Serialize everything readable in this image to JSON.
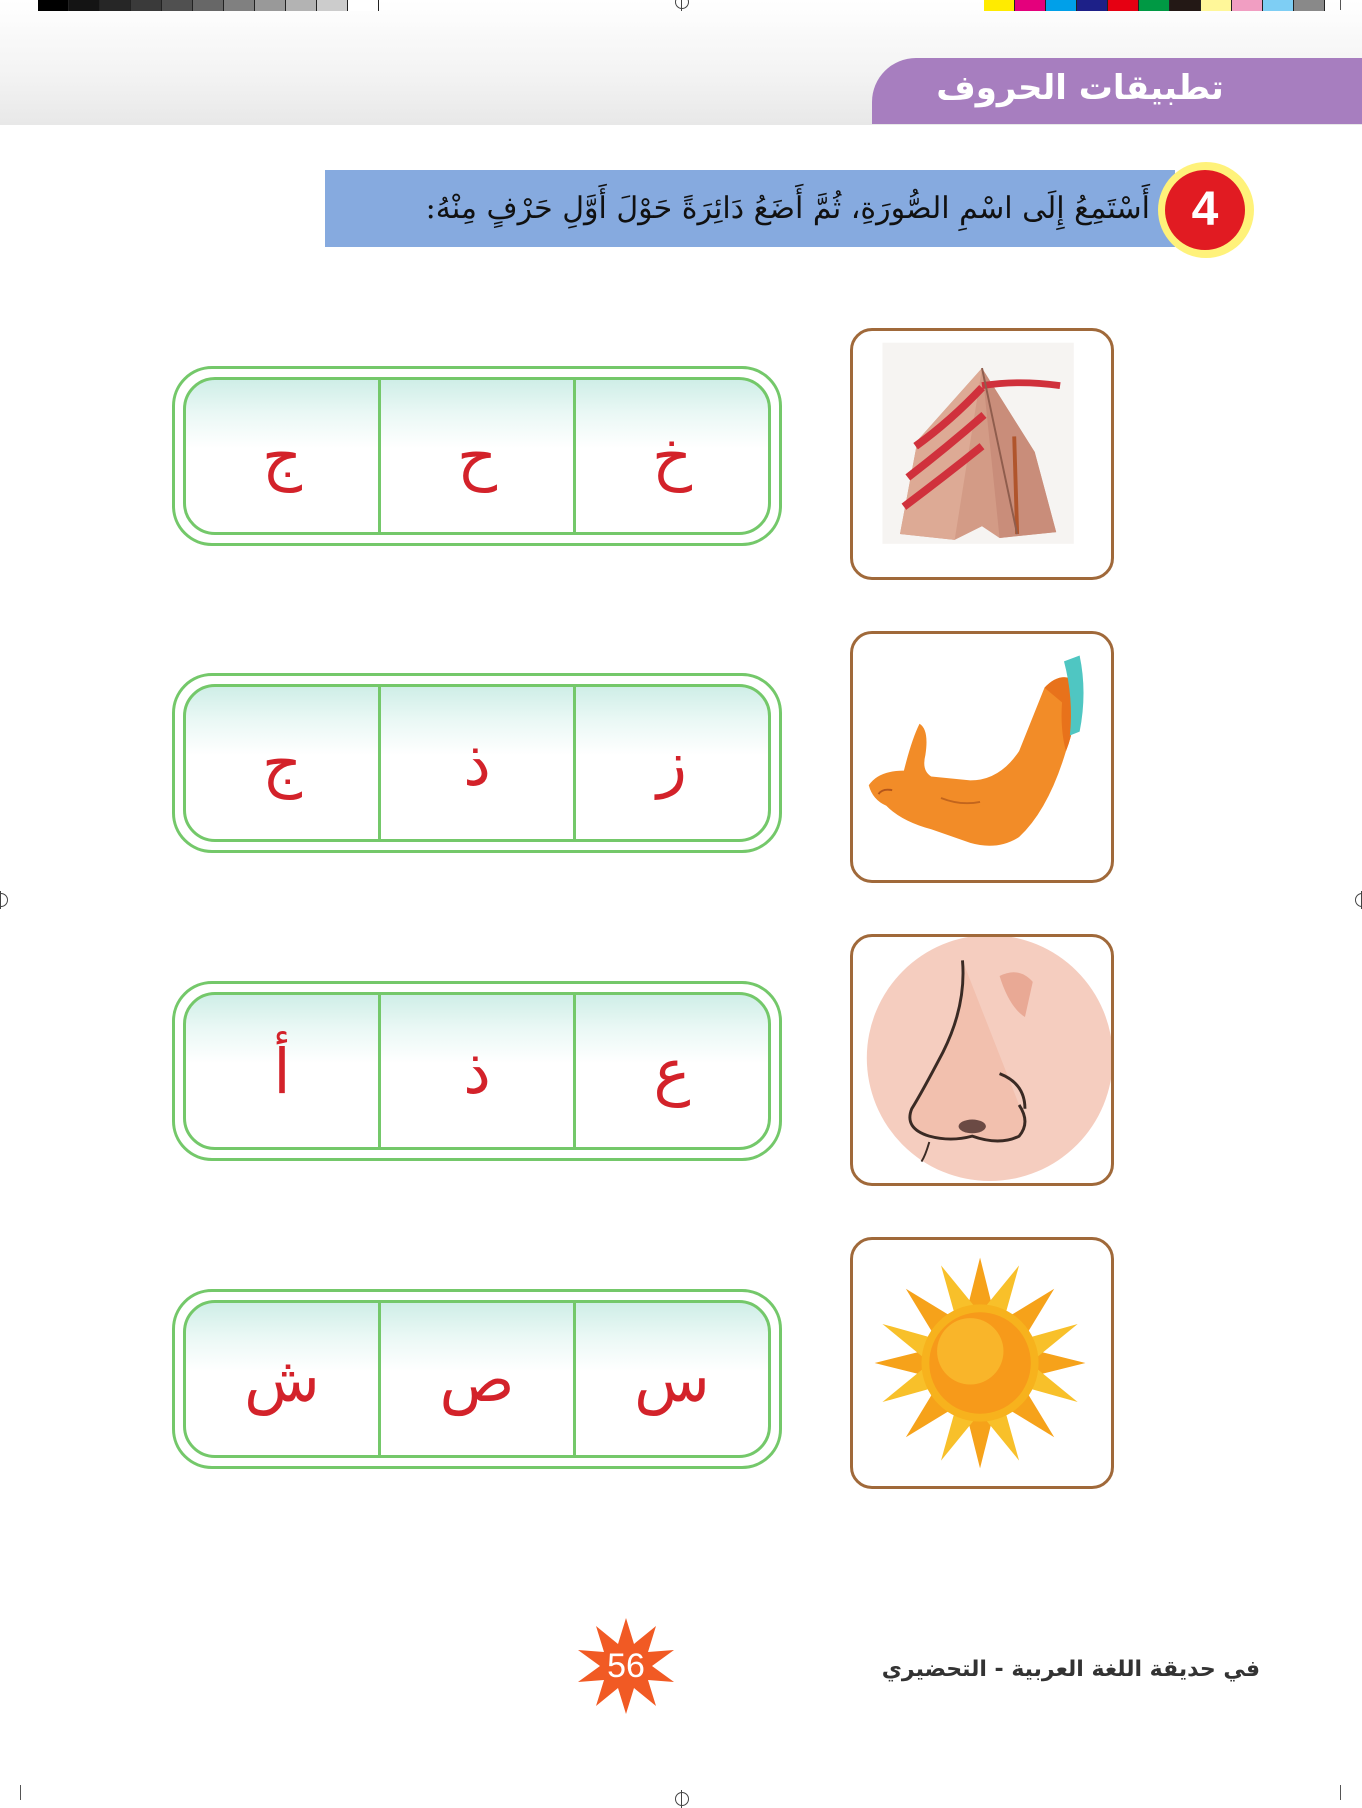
{
  "header": {
    "title": "تطبيقات الحروف"
  },
  "exercise": {
    "number": "4",
    "instruction": "أَسْتَمِعُ إِلَى اسْمِ الصُّورَةِ، ثُمَّ أَضَعُ دَائِرَةً حَوْلَ أَوَّلِ حَرْفٍ مِنْهُ:",
    "rows": [
      {
        "picture": "tent-icon",
        "letters": [
          "ج",
          "ح",
          "خ"
        ]
      },
      {
        "picture": "arm-icon",
        "letters": [
          "ج",
          "ذ",
          "ز"
        ]
      },
      {
        "picture": "nose-icon",
        "letters": [
          "أ",
          "ذ",
          "ع"
        ]
      },
      {
        "picture": "sun-icon",
        "letters": [
          "ش",
          "ص",
          "س"
        ]
      }
    ]
  },
  "footer": {
    "page_number": "56",
    "book_title": "في حديقة اللغة العربية - التحضيري"
  },
  "colors": {
    "header_tab": "#a77ebf",
    "instruction_bar": "#86aadf",
    "number_badge": "#e11b22",
    "number_ring": "#fff27a",
    "box_border": "#74c86a",
    "letter": "#d3222a",
    "picture_frame": "#a0693a",
    "page_star": "#f15a24"
  }
}
